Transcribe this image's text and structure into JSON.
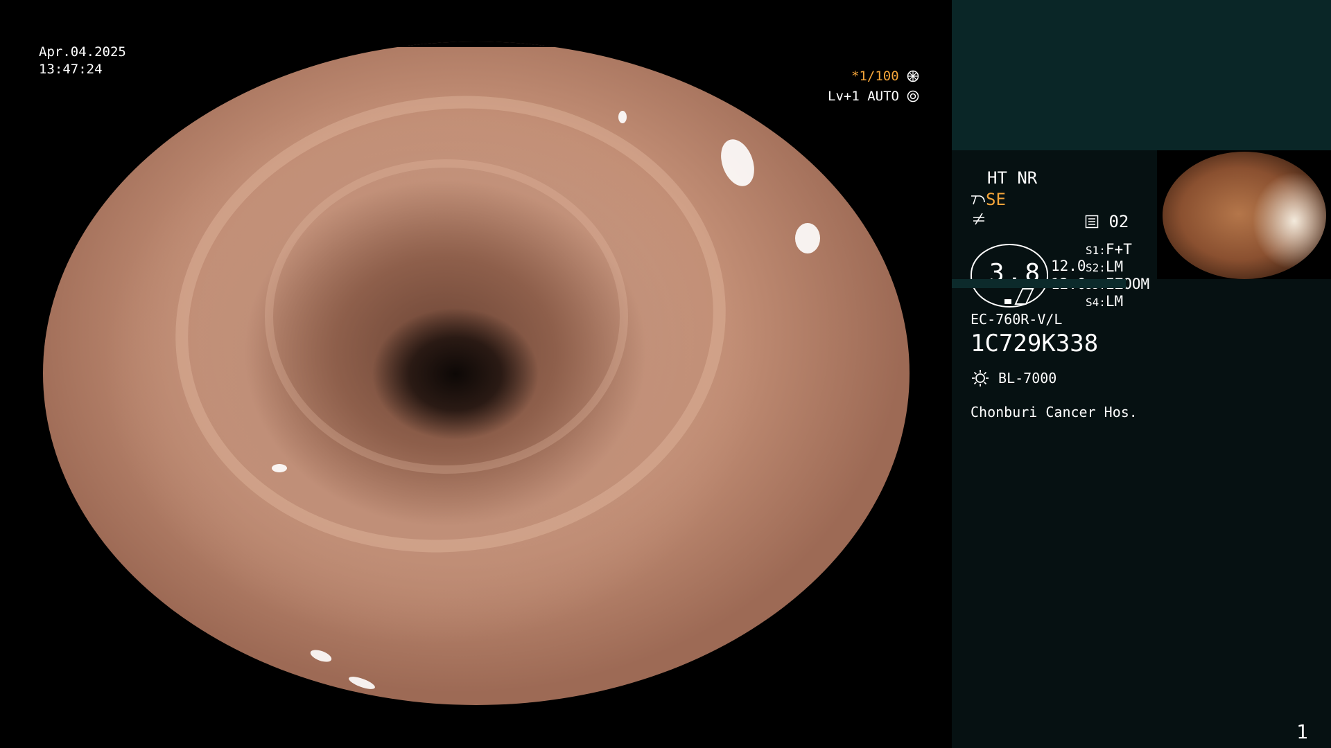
{
  "scope_overlay": {
    "date": "Apr.04.2025",
    "time": "13:47:24",
    "shutter": "*1/100",
    "iris": "Lv+1 AUTO"
  },
  "panel": {
    "ht_nr": "HT NR",
    "se": "SE",
    "setting_num": "02",
    "gauge_value": "3.8",
    "val1": "12.0",
    "val2": "12.0",
    "switches": [
      {
        "key": "S1",
        "value": "F+T"
      },
      {
        "key": "S2",
        "value": "LM"
      },
      {
        "key": "S3",
        "value": "EZOOM"
      },
      {
        "key": "S4",
        "value": "LM"
      }
    ],
    "scope_model": "EC-760R-V/L",
    "serial": "1C729K338",
    "light_source": "BL-7000",
    "hospital": "Chonburi Cancer Hos.",
    "page_number": "1"
  },
  "colors": {
    "accent_orange": "#f5a53a",
    "panel_bg": "#061112",
    "panel_top_bg": "#0a2627"
  },
  "icons": {
    "shutter": "aperture-icon",
    "iris": "iris-icon",
    "scope": "scope-icon",
    "freeze": "freeze-icon",
    "memo": "memo-icon",
    "light": "sun-icon"
  }
}
